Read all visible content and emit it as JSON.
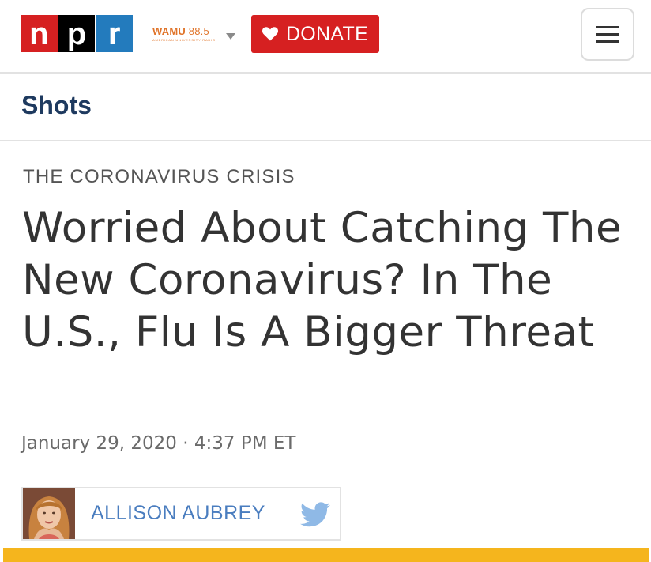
{
  "header": {
    "logo_letters": [
      "n",
      "p",
      "r"
    ],
    "station_name_bold": "WAMU",
    "station_frequency": "88.5",
    "station_subtitle": "AMERICAN UNIVERSITY RADIO",
    "donate_label": "DONATE",
    "menu_icon": "hamburger-menu-icon"
  },
  "section": {
    "title": "Shots"
  },
  "article": {
    "kicker": "THE CORONAVIRUS CRISIS",
    "headline": "Worried About Catching The New Coronavirus? In The U.S., Flu Is A Bigger Threat",
    "dateline": "January 29, 2020 · 4:37 PM ET",
    "author": "ALLISON AUBREY",
    "author_social_icon": "twitter-icon"
  },
  "colors": {
    "npr_red": "#d62021",
    "npr_black": "#000000",
    "npr_blue": "#237bbd",
    "station_orange": "#e0742a",
    "section_navy": "#1e3a5f",
    "author_blue": "#4a7dbf",
    "twitter_blue": "#8fb9e6",
    "accent_yellow": "#f5b51d"
  }
}
